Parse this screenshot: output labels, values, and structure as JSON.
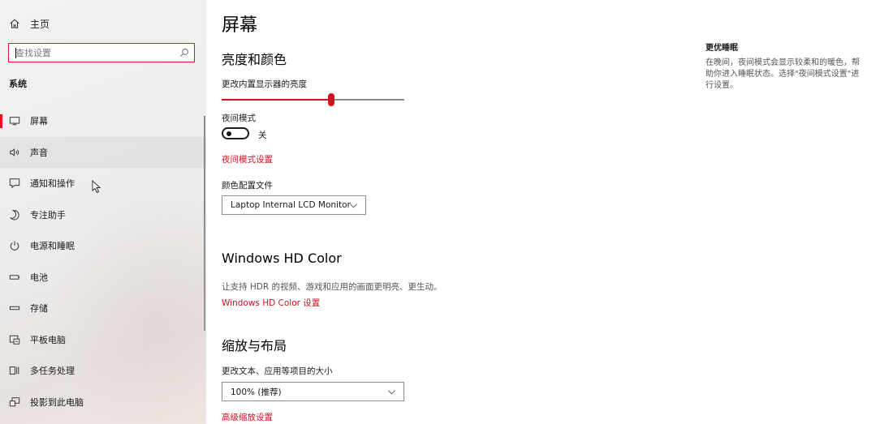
{
  "sidebar": {
    "home_label": "主页",
    "search": {
      "placeholder": "查找设置"
    },
    "section_title": "系统",
    "items": [
      {
        "label": "屏幕",
        "icon": "monitor-icon",
        "active": true
      },
      {
        "label": "声音",
        "icon": "speaker-icon"
      },
      {
        "label": "通知和操作",
        "icon": "notification-icon"
      },
      {
        "label": "专注助手",
        "icon": "moon-icon"
      },
      {
        "label": "电源和睡眠",
        "icon": "power-icon"
      },
      {
        "label": "电池",
        "icon": "battery-icon"
      },
      {
        "label": "存储",
        "icon": "storage-icon"
      },
      {
        "label": "平板电脑",
        "icon": "tablet-icon"
      },
      {
        "label": "多任务处理",
        "icon": "multitask-icon"
      },
      {
        "label": "投影到此电脑",
        "icon": "project-icon"
      }
    ]
  },
  "main": {
    "title": "屏幕",
    "brightness": {
      "heading": "亮度和颜色",
      "slider_label": "更改内置显示器的亮度",
      "value_fraction": 0.6
    },
    "night_mode": {
      "label": "夜间模式",
      "state": "关",
      "settings_link": "夜间模式设置"
    },
    "color_profile": {
      "label": "颜色配置文件",
      "selected": "Laptop Internal LCD Monitor"
    },
    "hdr": {
      "heading": "Windows HD Color",
      "description": "让支持 HDR 的视频、游戏和应用的画面更明亮、更生动。",
      "link": "Windows HD Color 设置"
    },
    "scale": {
      "heading": "缩放与布局",
      "label": "更改文本、应用等项目的大小",
      "selected": "100% (推荐)",
      "advanced_link": "高级缩放设置"
    }
  },
  "related": {
    "title": "更优睡眠",
    "text": "在晚间，夜间模式会显示较柔和的暖色，帮助你进入睡眠状态。选择\"夜间模式设置\"进行设置。"
  },
  "colors": {
    "accent": "#d2121e",
    "search_border": "#e81123"
  }
}
